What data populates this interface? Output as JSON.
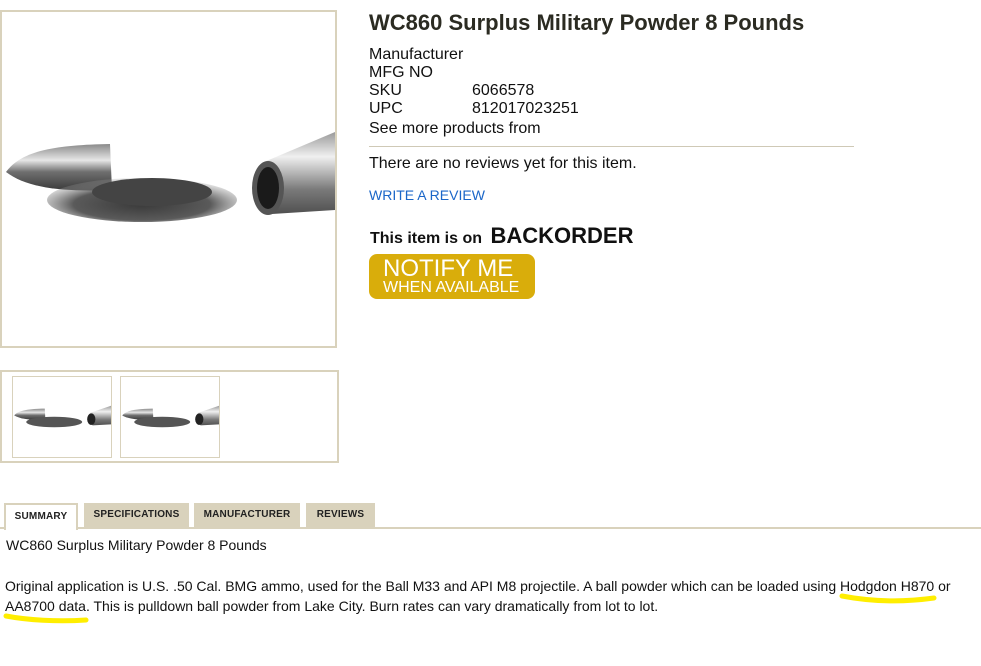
{
  "product": {
    "title": "WC860 Surplus Military Powder 8 Pounds",
    "specs": [
      {
        "label": "Manufacturer",
        "value": ""
      },
      {
        "label": "MFG NO",
        "value": ""
      },
      {
        "label": "SKU",
        "value": "6066578"
      },
      {
        "label": "UPC",
        "value": "812017023251"
      }
    ],
    "see_more": "See more products from"
  },
  "reviews": {
    "none_text": "There are no reviews yet for this item.",
    "write_label": "WRITE A REVIEW"
  },
  "stock": {
    "prefix": "This item is on",
    "status": "BACKORDER"
  },
  "notify_button": {
    "line1": "NOTIFY ME",
    "line2": "WHEN AVAILABLE",
    "color": "#d9ad0b"
  },
  "tabs": [
    "SUMMARY",
    "SPECIFICATIONS",
    "MANUFACTURER",
    "REVIEWS"
  ],
  "active_tab": "SUMMARY",
  "summary": {
    "title": "WC860 Surplus Military Powder 8 Pounds",
    "part1": "Original application is U.S. .50 Cal. BMG ammo, used for the Ball M33 and API M8 projectile. A ball powder which can be loaded using ",
    "highlight1": "Hodgdon H870",
    "part2": " or ",
    "highlight2": "AA8700 data",
    "part3": ". This is pulldown ball powder from Lake City. Burn rates can vary dramatically from lot to lot."
  },
  "images": {
    "main": "bullet-powder-casing-image",
    "thumbnails": [
      "bullet-powder-casing-image",
      "bullet-powder-casing-image"
    ]
  },
  "colors": {
    "border": "#d9d2bc",
    "link": "#1a66c8",
    "highlight_marker": "#ffee00"
  }
}
